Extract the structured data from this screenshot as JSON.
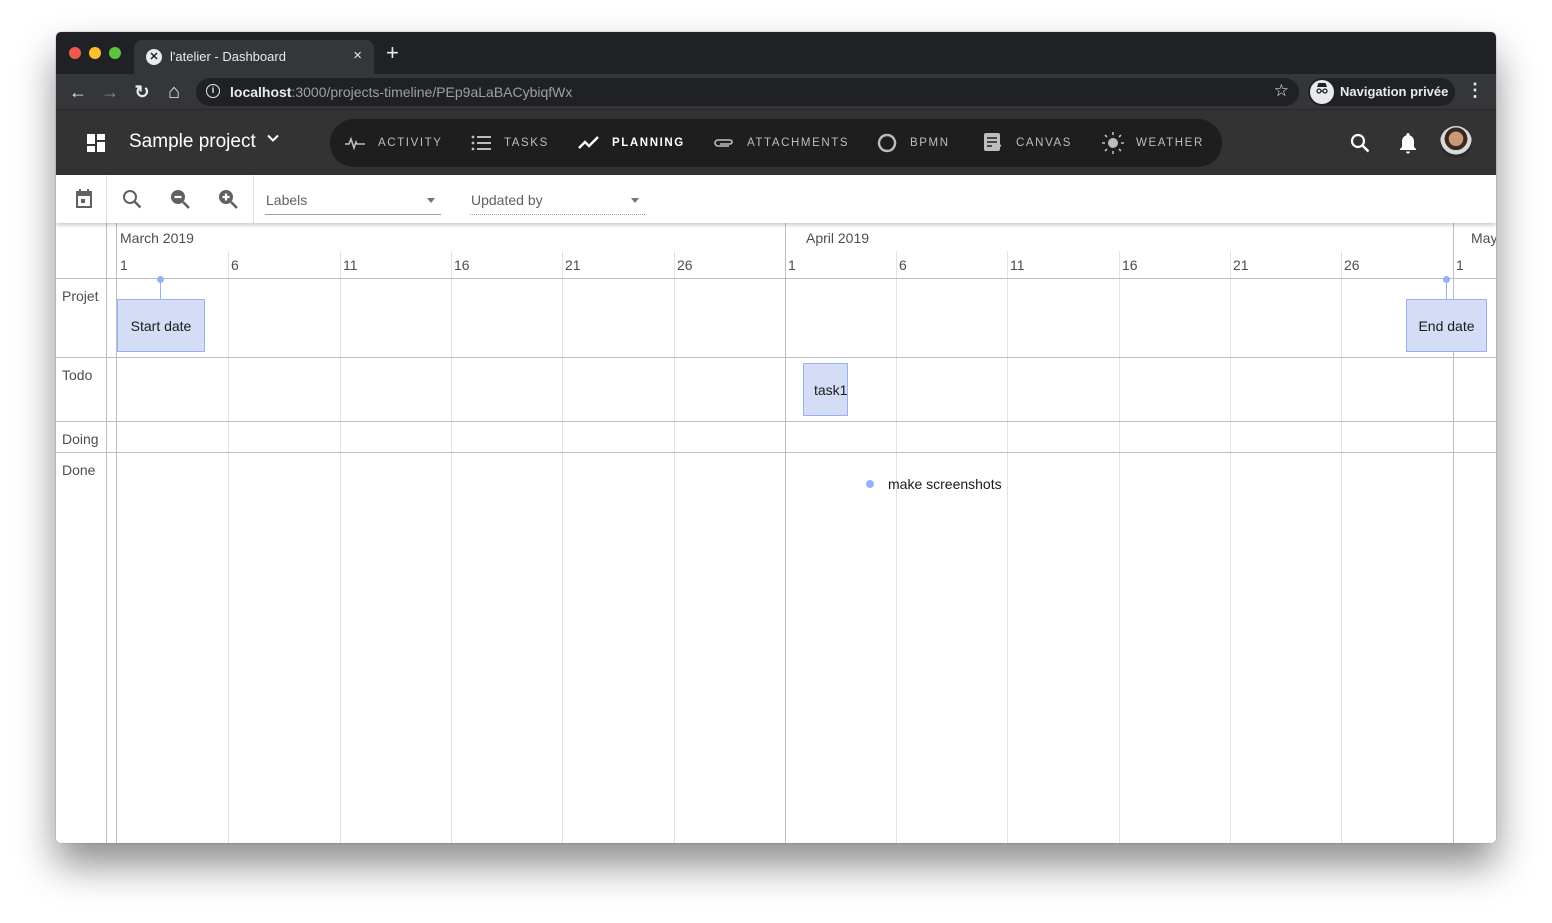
{
  "browser": {
    "tab_title": "l'atelier - Dashboard",
    "tab_close": "×",
    "new_tab": "+",
    "url_host": "localhost",
    "url_rest": ":3000/projects-timeline/PEp9aLaBACybiqfWx",
    "profile_label": "Navigation privée",
    "back": "←",
    "forward": "→",
    "reload": "↻",
    "home": "⌂",
    "bookmark": "☆",
    "menu": "⋮"
  },
  "app": {
    "project_name": "Sample project",
    "nav": [
      {
        "label": "ACTIVITY",
        "icon": "activity-icon",
        "active": false
      },
      {
        "label": "TASKS",
        "icon": "list-icon",
        "active": false
      },
      {
        "label": "PLANNING",
        "icon": "trending-icon",
        "active": true
      },
      {
        "label": "ATTACHMENTS",
        "icon": "paperclip-icon",
        "active": false
      },
      {
        "label": "BPMN",
        "icon": "circle-icon",
        "active": false
      },
      {
        "label": "CANVAS",
        "icon": "canvas-icon",
        "active": false
      },
      {
        "label": "WEATHER",
        "icon": "sun-icon",
        "active": false
      }
    ]
  },
  "toolbar": {
    "labels_select": "Labels",
    "updated_by_select": "Updated by"
  },
  "timeline": {
    "months": [
      {
        "label": "March 2019"
      },
      {
        "label": "April 2019"
      },
      {
        "label": "May"
      }
    ],
    "days": [
      "1",
      "6",
      "11",
      "16",
      "21",
      "26",
      "1",
      "6",
      "11",
      "16",
      "21",
      "26",
      "1"
    ],
    "groups": [
      {
        "label": "Projet"
      },
      {
        "label": "Todo"
      },
      {
        "label": "Doing"
      },
      {
        "label": "Done"
      }
    ],
    "items": [
      {
        "label": "Start date",
        "group": "Projet",
        "date": "2019-03-04"
      },
      {
        "label": "End date",
        "group": "Projet",
        "date": "2019-04-29"
      },
      {
        "label": "task1",
        "group": "Todo",
        "start": "2019-04-01",
        "end": "2019-04-03"
      },
      {
        "label": "make screenshots",
        "group": "Done",
        "date": "2019-04-07"
      }
    ]
  },
  "colors": {
    "item_fill": "#d5ddf6",
    "item_border": "#97b0f8",
    "appbar": "#333333",
    "nav_pill": "#1e1e1e"
  }
}
